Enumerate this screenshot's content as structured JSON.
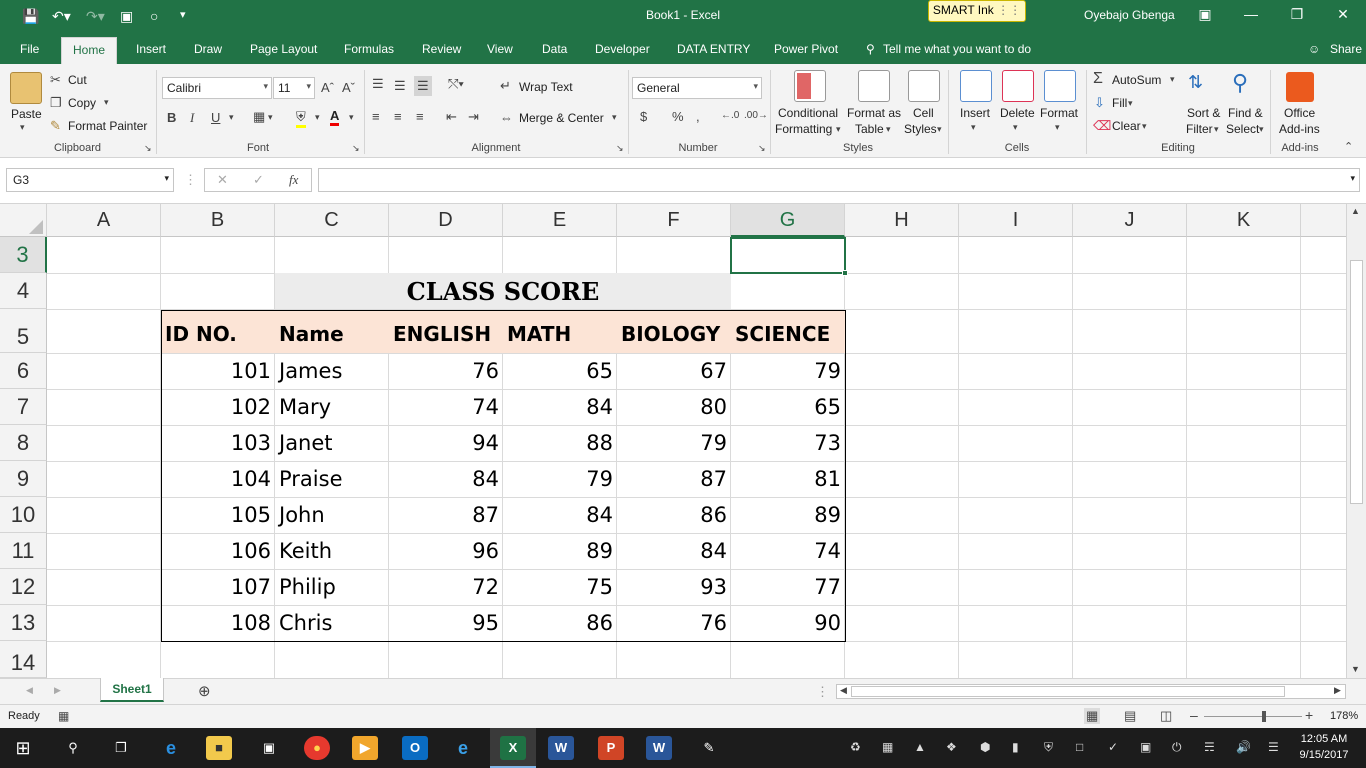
{
  "titlebar": {
    "title": "Book1  -  Excel",
    "smart_ink": "SMART Ink",
    "user": "Oyebajo Gbenga"
  },
  "tabs": [
    "File",
    "Home",
    "Insert",
    "Draw",
    "Page Layout",
    "Formulas",
    "Review",
    "View",
    "Data",
    "Developer",
    "DATA ENTRY",
    "Power Pivot"
  ],
  "tell_me": "Tell me what you want to do",
  "share": "Share",
  "ribbon": {
    "clipboard": {
      "paste": "Paste",
      "cut": "Cut",
      "copy": "Copy",
      "format_painter": "Format Painter",
      "label": "Clipboard"
    },
    "font": {
      "name": "Calibri",
      "size": "11",
      "label": "Font",
      "bold": "B",
      "italic": "I",
      "underline": "U"
    },
    "alignment": {
      "wrap_text": "Wrap Text",
      "merge_center": "Merge & Center",
      "label": "Alignment"
    },
    "number": {
      "format": "General",
      "currency": "$",
      "percent": "%",
      "comma": ",",
      "label": "Number"
    },
    "styles": {
      "conditional": "Conditional",
      "conditional2": "Formatting",
      "format_as": "Format as",
      "format_as2": "Table",
      "cell": "Cell",
      "cell2": "Styles",
      "label": "Styles"
    },
    "cells": {
      "insert": "Insert",
      "delete": "Delete",
      "format": "Format",
      "label": "Cells"
    },
    "editing": {
      "autosum": "AutoSum",
      "fill": "Fill",
      "clear": "Clear",
      "sort": "Sort &",
      "sort2": "Filter",
      "find": "Find &",
      "find2": "Select",
      "label": "Editing"
    },
    "addins": {
      "office": "Office",
      "office2": "Add-ins",
      "label": "Add-ins"
    }
  },
  "formula_bar": {
    "name_box": "G3",
    "fx": "fx",
    "formula": ""
  },
  "columns": [
    "A",
    "B",
    "C",
    "D",
    "E",
    "F",
    "G",
    "H",
    "I",
    "J",
    "K"
  ],
  "rows": [
    "3",
    "4",
    "5",
    "6",
    "7",
    "8",
    "9",
    "10",
    "11",
    "12",
    "13",
    "14"
  ],
  "sheet": {
    "title": "CLASS SCORE",
    "headers": [
      "ID NO.",
      "Name",
      "ENGLISH",
      "MATH",
      "BIOLOGY",
      "SCIENCE"
    ],
    "data": [
      [
        "101",
        "James",
        "76",
        "65",
        "67",
        "79"
      ],
      [
        "102",
        "Mary",
        "74",
        "84",
        "80",
        "65"
      ],
      [
        "103",
        "Janet",
        "94",
        "88",
        "79",
        "73"
      ],
      [
        "104",
        "Praise",
        "84",
        "79",
        "87",
        "81"
      ],
      [
        "105",
        "John",
        "87",
        "84",
        "86",
        "89"
      ],
      [
        "106",
        "Keith",
        "96",
        "89",
        "84",
        "74"
      ],
      [
        "107",
        "Philip",
        "72",
        "75",
        "93",
        "77"
      ],
      [
        "108",
        "Chris",
        "95",
        "86",
        "76",
        "90"
      ]
    ]
  },
  "sheet_tabs": [
    "Sheet1"
  ],
  "status": {
    "ready": "Ready",
    "zoom": "178%"
  },
  "taskbar": {
    "time": "12:05 AM",
    "date": "9/15/2017"
  },
  "colors": {
    "excel_green": "#217346",
    "header_fill": "#fce4d6",
    "title_fill": "#ececec"
  }
}
